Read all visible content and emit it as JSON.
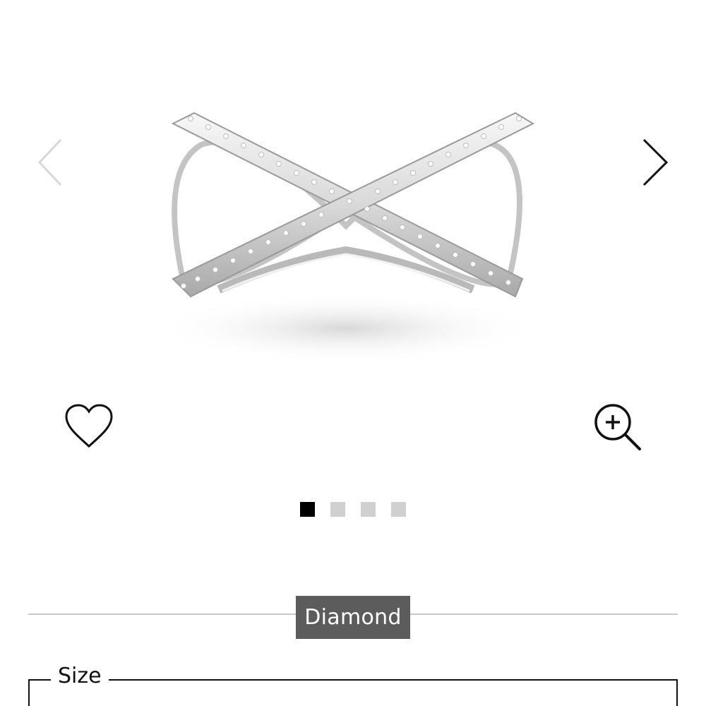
{
  "gallery": {
    "image_name": "crossover-pave-diamond-ring",
    "prev_icon": "chevron-left-icon",
    "next_icon": "chevron-right-icon",
    "wishlist_icon": "heart-icon",
    "zoom_icon": "zoom-in-icon",
    "slide_count": 4,
    "active_slide": 1
  },
  "variant": {
    "label": "Diamond"
  },
  "size": {
    "legend": "Size"
  },
  "colors": {
    "active_dot": "#000000",
    "inactive_dot": "#d0d0d0",
    "badge_bg": "#5c5c5c",
    "divider": "#c8c8c8"
  }
}
